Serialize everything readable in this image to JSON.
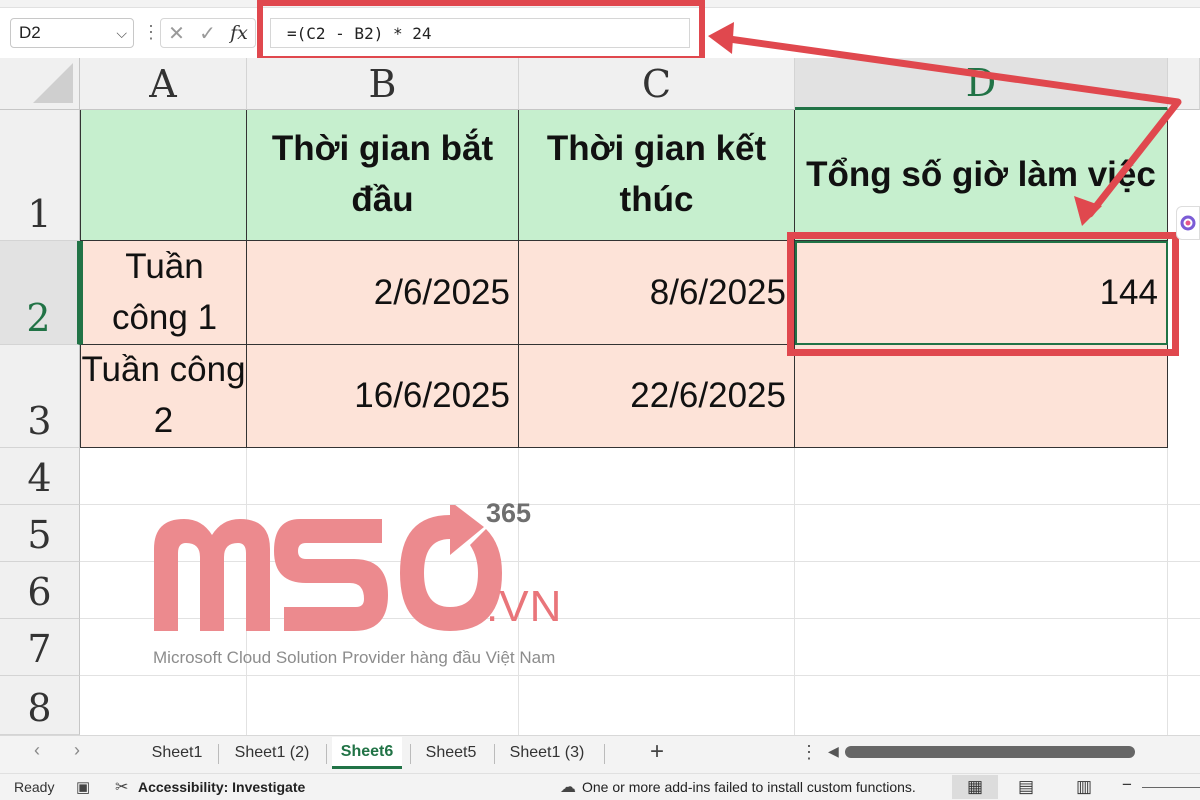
{
  "formula_bar": {
    "name_box": "D2",
    "separator": "⋮",
    "cancel_icon": "✕",
    "enter_icon": "✓",
    "fx_label": "fx",
    "formula": "=(C2 - B2) * 24"
  },
  "columns": [
    "A",
    "B",
    "C",
    "D"
  ],
  "rows": [
    "1",
    "2",
    "3",
    "4",
    "5",
    "6",
    "7",
    "8"
  ],
  "cells": {
    "A1": "",
    "B1": "Thời gian bắt đầu",
    "C1": "Thời gian kết thúc",
    "D1": "Tổng số giờ làm việc",
    "A2": "Tuần công 1",
    "B2": "2/6/2025",
    "C2": "8/6/2025",
    "D2": "144",
    "A3": "Tuần công 2",
    "B3": "16/6/2025",
    "C3": "22/6/2025",
    "D3": ""
  },
  "watermark": {
    "brand": "MSO",
    "superscript": "365",
    "domain": ".VN",
    "tagline": "Microsoft Cloud Solution Provider hàng đầu Việt Nam"
  },
  "sheet_tabs": [
    {
      "label": "Sheet1",
      "active": false
    },
    {
      "label": "Sheet1 (2)",
      "active": false
    },
    {
      "label": "Sheet6",
      "active": true
    },
    {
      "label": "Sheet5",
      "active": false
    },
    {
      "label": "Sheet1 (3)",
      "active": false
    }
  ],
  "tab_controls": {
    "prev": "‹",
    "next": "›",
    "add": "+",
    "more": "⋮",
    "scroll_left": "◀"
  },
  "status_bar": {
    "ready": "Ready",
    "accessibility": "Accessibility: Investigate",
    "addin_message": "One or more add-ins failed to install custom functions.",
    "zoom_minus": "−"
  },
  "colors": {
    "accent_green": "#217346",
    "header_fill": "#c6efce",
    "data_fill": "#fde3d8",
    "highlight_red": "#e0484e",
    "watermark_pink": "#e9757a"
  },
  "icons": {
    "name_box_dropdown": "chevron-down-icon",
    "cancel": "close-icon",
    "enter": "check-icon",
    "accessibility": "accessibility-icon",
    "addin": "cloud-warning-icon",
    "normal_view": "grid-icon",
    "page_layout": "page-icon",
    "page_break": "page-break-icon"
  }
}
